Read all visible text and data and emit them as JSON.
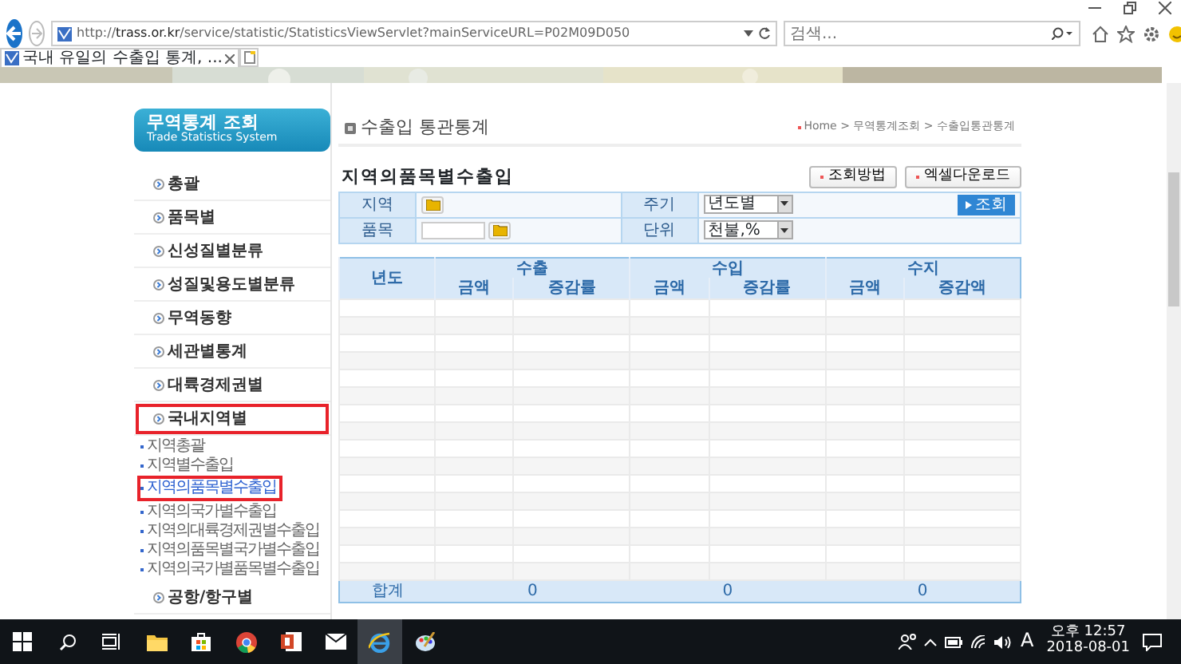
{
  "browser": {
    "address": "http://**trass.or.kr**/service/statistic/StatisticsViewServlet?mainServiceURL=P02M09D050",
    "search_placeholder": "검색...",
    "tabs": [
      {
        "title": "국내 유일의 수출입 통계, ...",
        "selected": true
      }
    ]
  },
  "sidebar": {
    "title": "무역통계 조회",
    "subtitle": "Trade Statistics System",
    "items": [
      {
        "label": "총괄",
        "boxed": false
      },
      {
        "label": "품목별",
        "boxed": false
      },
      {
        "label": "신성질별분류",
        "boxed": false
      },
      {
        "label": "성질및용도별분류",
        "boxed": false
      },
      {
        "label": "무역동향",
        "boxed": false
      },
      {
        "label": "세관별통계",
        "boxed": false
      },
      {
        "label": "대륙경제권별",
        "boxed": false
      },
      {
        "label": "국내지역별",
        "boxed": true,
        "children": [
          {
            "label": "지역총괄",
            "selected": false,
            "boxed": false
          },
          {
            "label": "지역별수출입",
            "selected": false,
            "boxed": false
          },
          {
            "label": "지역의품목별수출입",
            "selected": true,
            "boxed": true
          },
          {
            "label": "지역의국가별수출입",
            "selected": false,
            "boxed": false
          },
          {
            "label": "지역의대륙경제권별수출입",
            "selected": false,
            "boxed": false
          },
          {
            "label": "지역의품목별국가별수출입",
            "selected": false,
            "boxed": false
          },
          {
            "label": "지역의국가별품목별수출입",
            "selected": false,
            "boxed": false
          }
        ]
      },
      {
        "label": "공항/항구별",
        "boxed": false
      }
    ]
  },
  "main": {
    "section_title": "수출입 통관통계",
    "breadcrumb": "Home > 무역통계조회 > 수출입통관통계",
    "page_title": "지역의품목별수출입",
    "buttons": [
      "조회방법",
      "엑셀다운로드"
    ],
    "form": {
      "region_label": "지역",
      "item_label": "품목",
      "period_label": "주기",
      "period_value": "년도별",
      "unit_label": "단위",
      "unit_value": "천불,%",
      "search_button": "조회"
    },
    "table": {
      "year_column": "년도",
      "groups": [
        {
          "title": "수출",
          "columns": [
            "금액",
            "증감률"
          ]
        },
        {
          "title": "수입",
          "columns": [
            "금액",
            "증감률"
          ]
        },
        {
          "title": "수지",
          "columns": [
            "금액",
            "증감액"
          ]
        }
      ],
      "total_label": "합계",
      "totals": [
        "0",
        "0",
        "0"
      ]
    }
  },
  "taskbar": {
    "ime": "A",
    "time": "오후 12:57",
    "date": "2018-08-01"
  }
}
